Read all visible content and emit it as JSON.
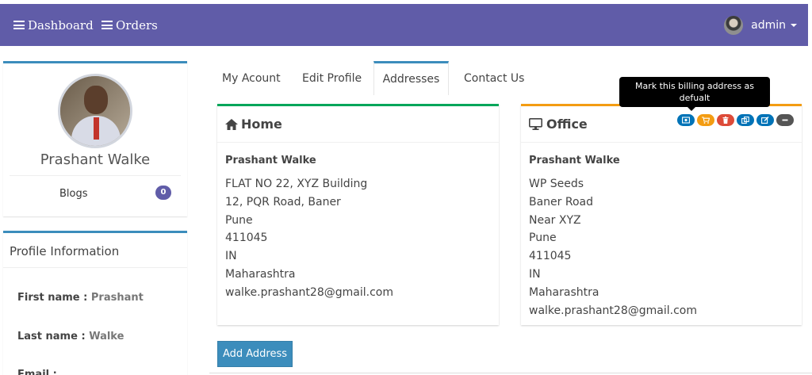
{
  "navbar": {
    "dashboard_label": "Dashboard",
    "orders_label": "Orders",
    "user_name": "admin",
    "bg_color": "#605ca8"
  },
  "profile": {
    "name": "Prashant Walke",
    "blogs_label": "Blogs",
    "blogs_count": "0"
  },
  "profile_info": {
    "title": "Profile Information",
    "rows": [
      {
        "label": "First name : ",
        "value": "Prashant"
      },
      {
        "label": "Last name : ",
        "value": "Walke"
      },
      {
        "label": "Email :",
        "value": ""
      }
    ]
  },
  "tabs": [
    {
      "label": "My Acount"
    },
    {
      "label": "Edit Profile"
    },
    {
      "label": "Addresses",
      "active": true
    },
    {
      "label": "Contact Us"
    }
  ],
  "addresses": [
    {
      "title": "Home",
      "icon": "home-icon",
      "accent": "#00a65a",
      "lines": [
        "Prashant Walke",
        "FLAT NO 22, XYZ Building",
        "12, PQR Road, Baner",
        "Pune",
        "411045",
        "IN",
        "Maharashtra",
        "walke.prashant28@gmail.com"
      ]
    },
    {
      "title": "Office",
      "icon": "desktop-icon",
      "accent": "#f39c12",
      "lines": [
        "Prashant Walke",
        "WP Seeds",
        "Baner Road",
        "Near XYZ",
        "Pune",
        "411045",
        "IN",
        "Maharashtra",
        "walke.prashant28@gmail.com"
      ],
      "actions": [
        {
          "icon": "billing-icon",
          "color": "#0073b7"
        },
        {
          "icon": "cart-icon",
          "color": "#f39c12"
        },
        {
          "icon": "trash-icon",
          "color": "#dd4b39"
        },
        {
          "icon": "copy-icon",
          "color": "#0073b7"
        },
        {
          "icon": "edit-icon",
          "color": "#0073b7"
        },
        {
          "icon": "minus-icon",
          "color": "#555555"
        }
      ]
    }
  ],
  "tooltip": {
    "text": "Mark this billing address as defualt"
  },
  "add_address_label": "Add Address"
}
